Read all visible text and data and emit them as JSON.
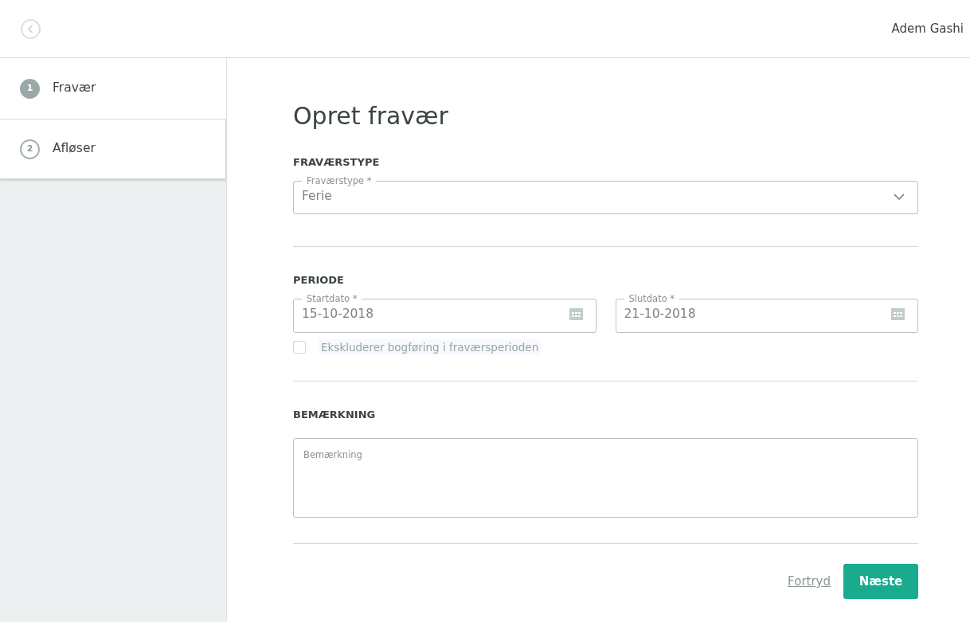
{
  "header": {
    "user_name": "Adem Gashi"
  },
  "steps": [
    {
      "number": "1",
      "label": "Fravær",
      "selected": true
    },
    {
      "number": "2",
      "label": "Afløser",
      "selected": false
    }
  ],
  "page_title": "Opret fravær",
  "sections": [
    {
      "heading": "FRAVÆRSTYPE",
      "fields": [
        {
          "kind": "select",
          "label": "Fraværstype *",
          "value": "Ferie"
        }
      ]
    },
    {
      "heading": "PERIODE",
      "fields": [
        {
          "kind": "date",
          "label": "Startdato *",
          "value": "15-10-2018"
        },
        {
          "kind": "date",
          "label": "Slutdato *",
          "value": "21-10-2018"
        }
      ],
      "checkbox": {
        "label": "Ekskluderer bogføring i fraværsperioden",
        "checked": false
      }
    },
    {
      "heading": "BEMÆRKNING",
      "fields": [
        {
          "kind": "textarea",
          "placeholder": "Bemærkning"
        }
      ]
    }
  ],
  "actions": {
    "cancel": "Fortryd",
    "next": "Næste"
  }
}
